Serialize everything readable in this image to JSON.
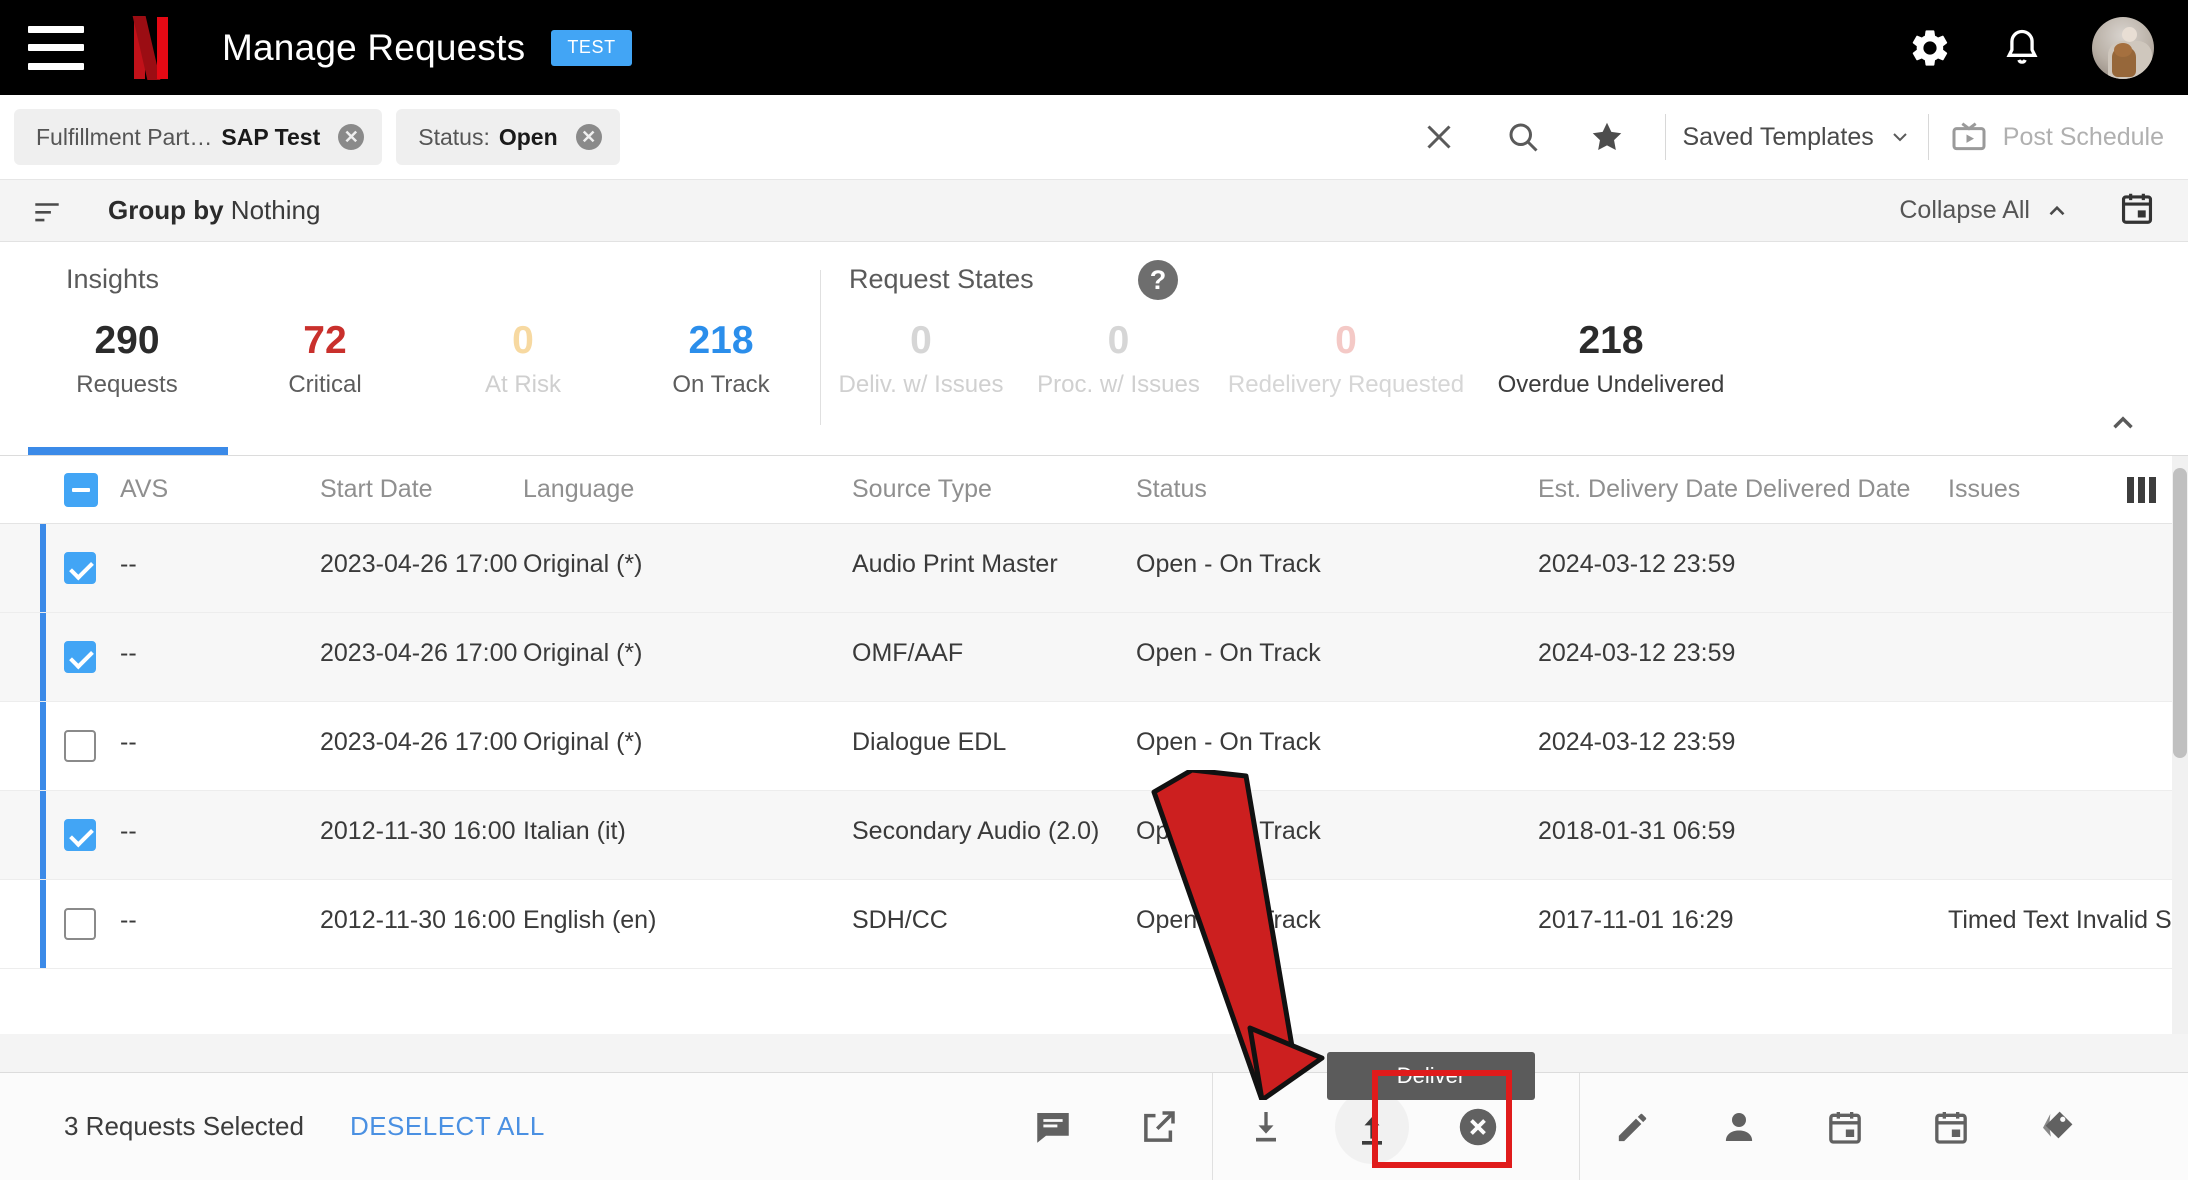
{
  "topbar": {
    "menu_icon": "hamburger-menu-icon",
    "logo": "netflix-logo",
    "title": "Manage Requests",
    "env_badge": "TEST",
    "settings_icon": "gear-icon",
    "notifications_icon": "bell-icon",
    "avatar": "user-avatar"
  },
  "filterbar": {
    "chips": [
      {
        "key": "Fulfillment Part…",
        "value": "SAP Test",
        "remove": "✕"
      },
      {
        "key": "Status:",
        "value": "Open",
        "remove": "✕"
      }
    ],
    "clear_icon": "close-icon",
    "search_icon": "search-icon",
    "favorite_icon": "star-icon",
    "saved_templates": "Saved Templates",
    "saved_templates_caret": "chevron-down-icon",
    "post_schedule": "Post Schedule",
    "post_schedule_icon": "tv-play-icon"
  },
  "groupbar": {
    "sort_icon": "group-sort-icon",
    "group_by_label": "Group by",
    "group_by_value": "Nothing",
    "collapse_all": "Collapse All",
    "collapse_caret": "chevron-up-icon",
    "calendar_icon": "calendar-icon"
  },
  "insights": {
    "section_title": "Insights",
    "help_icon": "help-circle-icon",
    "collapse_icon": "chevron-up-icon",
    "stats": [
      {
        "value": "290",
        "label": "Requests",
        "color": "#2b2b2b",
        "selected": true
      },
      {
        "value": "72",
        "label": "Critical",
        "color": "#c9302c",
        "selected": false
      },
      {
        "value": "0",
        "label": "At Risk",
        "color": "#f5d9a8",
        "label_color": "#c9c9c9",
        "selected": false
      },
      {
        "value": "218",
        "label": "On Track",
        "color": "#2b8eeb",
        "selected": false
      }
    ],
    "states_title": "Request States",
    "states": [
      {
        "value": "0",
        "label": "Deliv. w/ Issues",
        "color": "#d6d6d6",
        "label_color": "#d0d0d0"
      },
      {
        "value": "0",
        "label": "Proc. w/ Issues",
        "color": "#d6d6d6",
        "label_color": "#d0d0d0"
      },
      {
        "value": "0",
        "label": "Redelivery Requested",
        "color": "#f2c9c7",
        "label_color": "#d9d9d9"
      },
      {
        "value": "218",
        "label": "Overdue Undelivered",
        "color": "#2b2b2b",
        "label_color": "#3c3c3c"
      }
    ]
  },
  "table": {
    "columns": [
      "AVS",
      "Start Date",
      "Language",
      "Source Type",
      "Status",
      "Est. Delivery Date",
      "Delivered Date",
      "Issues"
    ],
    "columns_icon": "column-settings-icon",
    "header_checkbox": "indeterminate-checkbox",
    "rows": [
      {
        "checked": true,
        "avs": "--",
        "start_date": "2023-04-26 17:00",
        "language": "Original (*)",
        "source_type": "Audio Print Master",
        "status": "Open - On Track",
        "est_delivery": "2024-03-12 23:59",
        "delivered": "",
        "issues": ""
      },
      {
        "checked": true,
        "avs": "--",
        "start_date": "2023-04-26 17:00",
        "language": "Original (*)",
        "source_type": "OMF/AAF",
        "status": "Open - On Track",
        "est_delivery": "2024-03-12 23:59",
        "delivered": "",
        "issues": ""
      },
      {
        "checked": false,
        "avs": "--",
        "start_date": "2023-04-26 17:00",
        "language": "Original (*)",
        "source_type": "Dialogue EDL",
        "status": "Open - On Track",
        "est_delivery": "2024-03-12 23:59",
        "delivered": "",
        "issues": ""
      },
      {
        "checked": true,
        "avs": "--",
        "start_date": "2012-11-30 16:00",
        "language": "Italian (it)",
        "source_type": "Secondary Audio (2.0)",
        "status": "Open - On Track",
        "est_delivery": "2018-01-31 06:59",
        "delivered": "",
        "issues": ""
      },
      {
        "checked": false,
        "avs": "--",
        "start_date": "2012-11-30 16:00",
        "language": "English (en)",
        "source_type": "SDH/CC",
        "status": "Open - On Track",
        "est_delivery": "2017-11-01 16:29",
        "delivered": "",
        "issues": "Timed Text Invalid Sour"
      }
    ]
  },
  "bottombar": {
    "selection_text": "3 Requests Selected",
    "deselect_all": "DESELECT ALL",
    "actions": [
      {
        "name": "comment-icon",
        "group": 1
      },
      {
        "name": "open-external-icon",
        "group": 1
      },
      {
        "name": "download-icon",
        "group": 2
      },
      {
        "name": "deliver-upload-icon",
        "group": 2,
        "highlighted": true
      },
      {
        "name": "cancel-circle-icon",
        "group": 2
      },
      {
        "name": "edit-pencil-icon",
        "group": 3
      },
      {
        "name": "assign-person-icon",
        "group": 3
      },
      {
        "name": "calendar-start-icon",
        "group": 3
      },
      {
        "name": "calendar-due-icon",
        "group": 3
      },
      {
        "name": "tag-icon",
        "group": 3
      }
    ],
    "tooltip": "Deliver"
  },
  "annotation": {
    "arrow": "red-pointer-arrow",
    "highlight": "red-highlight-box",
    "color": "#cc1f1f"
  }
}
